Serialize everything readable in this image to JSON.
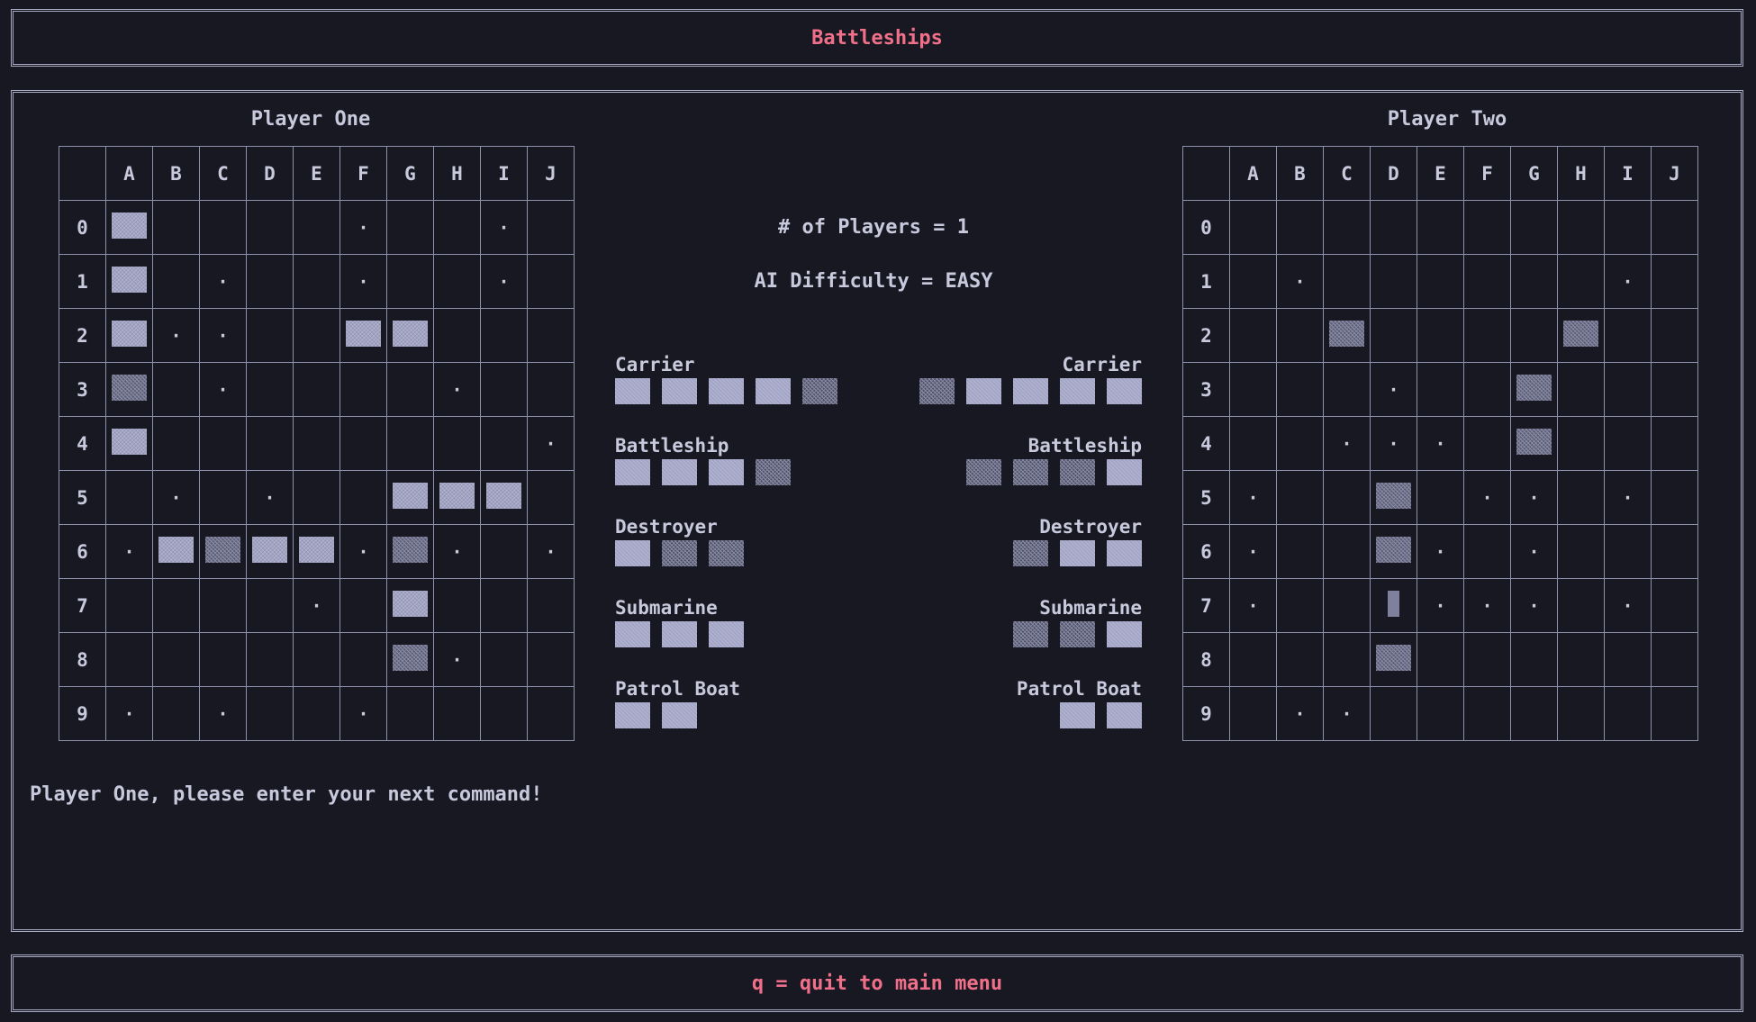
{
  "header": {
    "title": "Battleships"
  },
  "footer": {
    "hint": "q = quit to main menu"
  },
  "players": {
    "one_title": "Player One",
    "two_title": "Player Two"
  },
  "info": {
    "players_line": "# of Players = 1",
    "difficulty_line": "AI Difficulty = EASY"
  },
  "prompt": "Player One, please enter your next command!",
  "columns": [
    "A",
    "B",
    "C",
    "D",
    "E",
    "F",
    "G",
    "H",
    "I",
    "J"
  ],
  "rows": [
    "0",
    "1",
    "2",
    "3",
    "4",
    "5",
    "6",
    "7",
    "8",
    "9"
  ],
  "legend": {
    "ship": "S",
    "hit": "X",
    "miss": ".",
    "cursor": "C",
    "empty": " "
  },
  "board_one": [
    "S    .  . ",
    "S .  .  . ",
    "S..  SS   ",
    "X .    .  ",
    "S        .",
    " . .  SSS ",
    ".SXSS.X. .",
    "    . S   ",
    "      X.  ",
    ". .  .    "
  ],
  "board_two": [
    "          ",
    " .      . ",
    "  X    X  ",
    "   .  X   ",
    "  ... X   ",
    ".  X .. . ",
    ".  X. .   ",
    ".  C... . ",
    "   X      ",
    " ..       "
  ],
  "fleet_one": [
    {
      "name": "Carrier",
      "segments": [
        "intact",
        "intact",
        "intact",
        "intact",
        "hit"
      ]
    },
    {
      "name": "Battleship",
      "segments": [
        "intact",
        "intact",
        "intact",
        "hit"
      ]
    },
    {
      "name": "Destroyer",
      "segments": [
        "intact",
        "hit",
        "hit"
      ]
    },
    {
      "name": "Submarine",
      "segments": [
        "intact",
        "intact",
        "intact"
      ]
    },
    {
      "name": "Patrol Boat",
      "segments": [
        "intact",
        "intact"
      ]
    }
  ],
  "fleet_two": [
    {
      "name": "Carrier",
      "segments": [
        "hit",
        "intact",
        "intact",
        "intact",
        "intact"
      ]
    },
    {
      "name": "Battleship",
      "segments": [
        "hit",
        "hit",
        "hit",
        "intact"
      ]
    },
    {
      "name": "Destroyer",
      "segments": [
        "hit",
        "intact",
        "intact"
      ]
    },
    {
      "name": "Submarine",
      "segments": [
        "hit",
        "hit",
        "intact"
      ]
    },
    {
      "name": "Patrol Boat",
      "segments": [
        "intact",
        "intact"
      ]
    }
  ]
}
